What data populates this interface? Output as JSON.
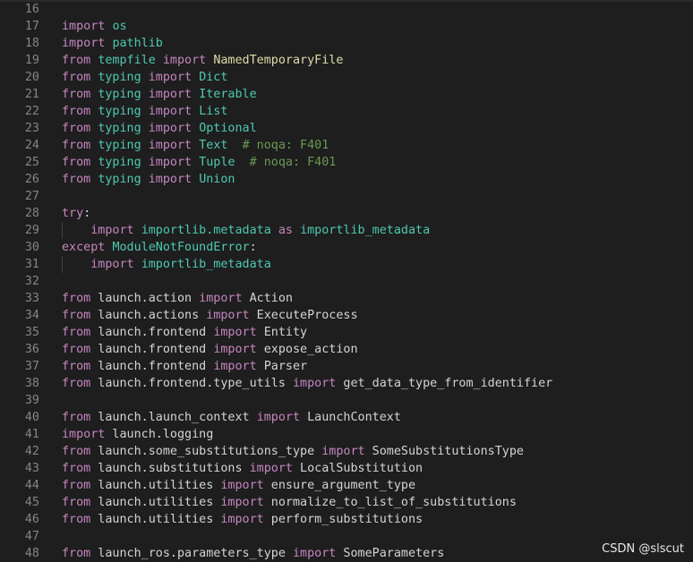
{
  "watermark": "CSDN @slscut",
  "lines": [
    {
      "n": "16",
      "indent": false,
      "tokens": []
    },
    {
      "n": "17",
      "indent": false,
      "tokens": [
        [
          "kw",
          "import"
        ],
        [
          "plain",
          " "
        ],
        [
          "mod",
          "os"
        ]
      ]
    },
    {
      "n": "18",
      "indent": false,
      "tokens": [
        [
          "kw",
          "import"
        ],
        [
          "plain",
          " "
        ],
        [
          "mod",
          "pathlib"
        ]
      ]
    },
    {
      "n": "19",
      "indent": false,
      "tokens": [
        [
          "kw",
          "from"
        ],
        [
          "plain",
          " "
        ],
        [
          "mod",
          "tempfile"
        ],
        [
          "plain",
          " "
        ],
        [
          "kw",
          "import"
        ],
        [
          "plain",
          " "
        ],
        [
          "cls",
          "NamedTemporaryFile"
        ]
      ]
    },
    {
      "n": "20",
      "indent": false,
      "tokens": [
        [
          "kw",
          "from"
        ],
        [
          "plain",
          " "
        ],
        [
          "mod",
          "typing"
        ],
        [
          "plain",
          " "
        ],
        [
          "kw",
          "import"
        ],
        [
          "plain",
          " "
        ],
        [
          "mod",
          "Dict"
        ]
      ]
    },
    {
      "n": "21",
      "indent": false,
      "tokens": [
        [
          "kw",
          "from"
        ],
        [
          "plain",
          " "
        ],
        [
          "mod",
          "typing"
        ],
        [
          "plain",
          " "
        ],
        [
          "kw",
          "import"
        ],
        [
          "plain",
          " "
        ],
        [
          "mod",
          "Iterable"
        ]
      ]
    },
    {
      "n": "22",
      "indent": false,
      "tokens": [
        [
          "kw",
          "from"
        ],
        [
          "plain",
          " "
        ],
        [
          "mod",
          "typing"
        ],
        [
          "plain",
          " "
        ],
        [
          "kw",
          "import"
        ],
        [
          "plain",
          " "
        ],
        [
          "mod",
          "List"
        ]
      ]
    },
    {
      "n": "23",
      "indent": false,
      "tokens": [
        [
          "kw",
          "from"
        ],
        [
          "plain",
          " "
        ],
        [
          "mod",
          "typing"
        ],
        [
          "plain",
          " "
        ],
        [
          "kw",
          "import"
        ],
        [
          "plain",
          " "
        ],
        [
          "mod",
          "Optional"
        ]
      ]
    },
    {
      "n": "24",
      "indent": false,
      "tokens": [
        [
          "kw",
          "from"
        ],
        [
          "plain",
          " "
        ],
        [
          "mod",
          "typing"
        ],
        [
          "plain",
          " "
        ],
        [
          "kw",
          "import"
        ],
        [
          "plain",
          " "
        ],
        [
          "mod",
          "Text"
        ],
        [
          "plain",
          "  "
        ],
        [
          "cmt",
          "# noqa: F401"
        ]
      ]
    },
    {
      "n": "25",
      "indent": false,
      "tokens": [
        [
          "kw",
          "from"
        ],
        [
          "plain",
          " "
        ],
        [
          "mod",
          "typing"
        ],
        [
          "plain",
          " "
        ],
        [
          "kw",
          "import"
        ],
        [
          "plain",
          " "
        ],
        [
          "mod",
          "Tuple"
        ],
        [
          "plain",
          "  "
        ],
        [
          "cmt",
          "# noqa: F401"
        ]
      ]
    },
    {
      "n": "26",
      "indent": false,
      "tokens": [
        [
          "kw",
          "from"
        ],
        [
          "plain",
          " "
        ],
        [
          "mod",
          "typing"
        ],
        [
          "plain",
          " "
        ],
        [
          "kw",
          "import"
        ],
        [
          "plain",
          " "
        ],
        [
          "mod",
          "Union"
        ]
      ]
    },
    {
      "n": "27",
      "indent": false,
      "tokens": []
    },
    {
      "n": "28",
      "indent": false,
      "tokens": [
        [
          "kw",
          "try"
        ],
        [
          "plain",
          ":"
        ]
      ]
    },
    {
      "n": "29",
      "indent": true,
      "tokens": [
        [
          "plain",
          "    "
        ],
        [
          "kw",
          "import"
        ],
        [
          "plain",
          " "
        ],
        [
          "mod",
          "importlib.metadata"
        ],
        [
          "plain",
          " "
        ],
        [
          "kw",
          "as"
        ],
        [
          "plain",
          " "
        ],
        [
          "mod",
          "importlib_metadata"
        ]
      ]
    },
    {
      "n": "30",
      "indent": false,
      "tokens": [
        [
          "kw",
          "except"
        ],
        [
          "plain",
          " "
        ],
        [
          "exc",
          "ModuleNotFoundError"
        ],
        [
          "plain",
          ":"
        ]
      ]
    },
    {
      "n": "31",
      "indent": true,
      "tokens": [
        [
          "plain",
          "    "
        ],
        [
          "kw",
          "import"
        ],
        [
          "plain",
          " "
        ],
        [
          "mod",
          "importlib_metadata"
        ]
      ]
    },
    {
      "n": "32",
      "indent": false,
      "tokens": []
    },
    {
      "n": "33",
      "indent": false,
      "tokens": [
        [
          "kw",
          "from"
        ],
        [
          "plain",
          " launch.action "
        ],
        [
          "kw",
          "import"
        ],
        [
          "plain",
          " Action"
        ]
      ]
    },
    {
      "n": "34",
      "indent": false,
      "tokens": [
        [
          "kw",
          "from"
        ],
        [
          "plain",
          " launch.actions "
        ],
        [
          "kw",
          "import"
        ],
        [
          "plain",
          " ExecuteProcess"
        ]
      ]
    },
    {
      "n": "35",
      "indent": false,
      "tokens": [
        [
          "kw",
          "from"
        ],
        [
          "plain",
          " launch.frontend "
        ],
        [
          "kw",
          "import"
        ],
        [
          "plain",
          " Entity"
        ]
      ]
    },
    {
      "n": "36",
      "indent": false,
      "tokens": [
        [
          "kw",
          "from"
        ],
        [
          "plain",
          " launch.frontend "
        ],
        [
          "kw",
          "import"
        ],
        [
          "plain",
          " expose_action"
        ]
      ]
    },
    {
      "n": "37",
      "indent": false,
      "tokens": [
        [
          "kw",
          "from"
        ],
        [
          "plain",
          " launch.frontend "
        ],
        [
          "kw",
          "import"
        ],
        [
          "plain",
          " Parser"
        ]
      ]
    },
    {
      "n": "38",
      "indent": false,
      "tokens": [
        [
          "kw",
          "from"
        ],
        [
          "plain",
          " launch.frontend.type_utils "
        ],
        [
          "kw",
          "import"
        ],
        [
          "plain",
          " get_data_type_from_identifier"
        ]
      ]
    },
    {
      "n": "39",
      "indent": false,
      "tokens": []
    },
    {
      "n": "40",
      "indent": false,
      "tokens": [
        [
          "kw",
          "from"
        ],
        [
          "plain",
          " launch.launch_context "
        ],
        [
          "kw",
          "import"
        ],
        [
          "plain",
          " LaunchContext"
        ]
      ]
    },
    {
      "n": "41",
      "indent": false,
      "tokens": [
        [
          "kw",
          "import"
        ],
        [
          "plain",
          " launch.logging"
        ]
      ]
    },
    {
      "n": "42",
      "indent": false,
      "tokens": [
        [
          "kw",
          "from"
        ],
        [
          "plain",
          " launch.some_substitutions_type "
        ],
        [
          "kw",
          "import"
        ],
        [
          "plain",
          " SomeSubstitutionsType"
        ]
      ]
    },
    {
      "n": "43",
      "indent": false,
      "tokens": [
        [
          "kw",
          "from"
        ],
        [
          "plain",
          " launch.substitutions "
        ],
        [
          "kw",
          "import"
        ],
        [
          "plain",
          " LocalSubstitution"
        ]
      ]
    },
    {
      "n": "44",
      "indent": false,
      "tokens": [
        [
          "kw",
          "from"
        ],
        [
          "plain",
          " launch.utilities "
        ],
        [
          "kw",
          "import"
        ],
        [
          "plain",
          " ensure_argument_type"
        ]
      ]
    },
    {
      "n": "45",
      "indent": false,
      "tokens": [
        [
          "kw",
          "from"
        ],
        [
          "plain",
          " launch.utilities "
        ],
        [
          "kw",
          "import"
        ],
        [
          "plain",
          " normalize_to_list_of_substitutions"
        ]
      ]
    },
    {
      "n": "46",
      "indent": false,
      "tokens": [
        [
          "kw",
          "from"
        ],
        [
          "plain",
          " launch.utilities "
        ],
        [
          "kw",
          "import"
        ],
        [
          "plain",
          " perform_substitutions"
        ]
      ]
    },
    {
      "n": "47",
      "indent": false,
      "tokens": []
    },
    {
      "n": "48",
      "indent": false,
      "tokens": [
        [
          "kw",
          "from"
        ],
        [
          "plain",
          " launch_ros.parameters_type "
        ],
        [
          "kw",
          "import"
        ],
        [
          "plain",
          " SomeParameters"
        ]
      ]
    }
  ]
}
